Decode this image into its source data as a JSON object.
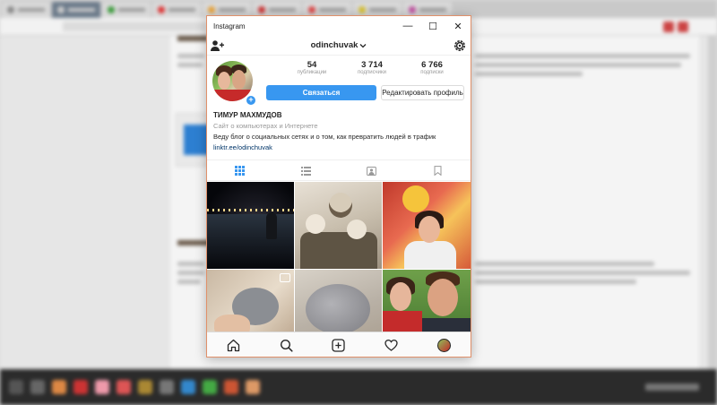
{
  "window": {
    "title": "Instagram",
    "controls": {
      "minimize": "—",
      "maximize": "☐",
      "close": "✕"
    }
  },
  "header": {
    "username": "odinchuvak",
    "icons": [
      "add-user-icon",
      "chevron-down-icon",
      "gear-icon"
    ]
  },
  "profile": {
    "stats": [
      {
        "value": "54",
        "label": "публикации"
      },
      {
        "value": "3 714",
        "label": "подписчики"
      },
      {
        "value": "6 766",
        "label": "подписки"
      }
    ],
    "connect_button": "Связаться",
    "edit_button": "Редактировать профиль",
    "badge": "+",
    "name": "ТИМУР МАХМУДОВ",
    "category": "Сайт о компьютерах и Интернете",
    "bio": "Веду блог о социальных сетях и о том, как превратить людей в трафик",
    "link": "linktr.ee/odinchuvak"
  },
  "tabs": [
    "grid-icon",
    "list-icon",
    "tagged-icon",
    "saved-icon"
  ],
  "bottom_nav": [
    "home-icon",
    "search-icon",
    "add-post-icon",
    "heart-icon",
    "profile-avatar"
  ],
  "colors": {
    "accent": "#3897f0",
    "window_border": "#e0906a",
    "link": "#003569"
  }
}
